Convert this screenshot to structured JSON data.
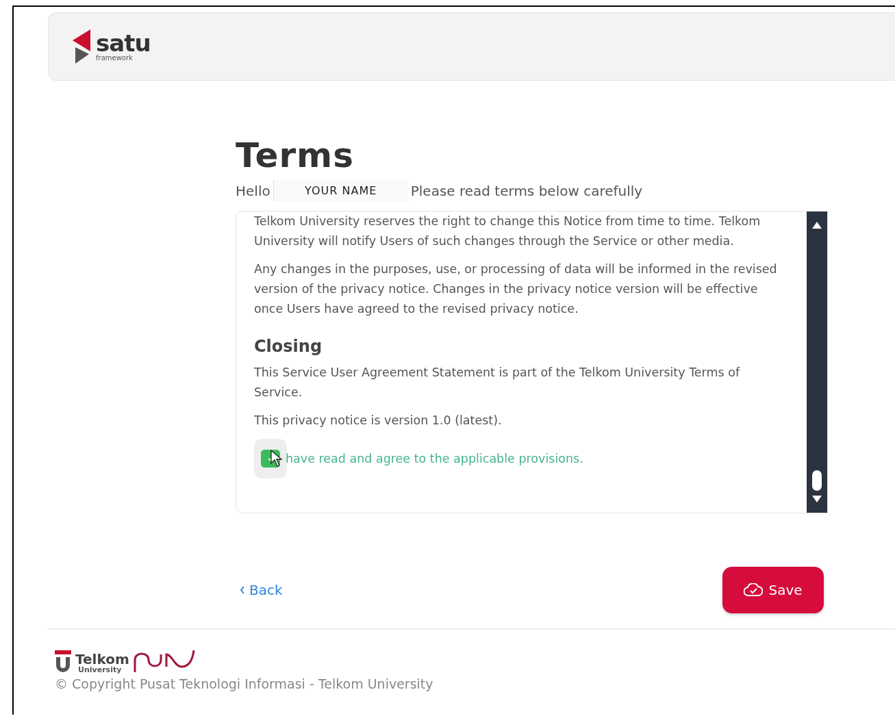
{
  "header": {
    "logo_name": "satu",
    "logo_sub": "framework"
  },
  "title": "Terms",
  "greeting": {
    "hello": "Hello",
    "name": "YOUR NAME",
    "instruction": "Please read terms below carefully"
  },
  "terms": {
    "blocks": [
      {
        "kind": "paragraph",
        "text": "Telkom University reserves the right to change this Notice from time to time. Telkom University will notify Users of such changes through the Service or other media."
      },
      {
        "kind": "paragraph",
        "text": "Any changes in the purposes, use, or processing of data will be informed in the revised version of the privacy notice. Changes in the privacy notice version will be effective once Users have agreed to the revised privacy notice."
      },
      {
        "kind": "heading",
        "text": "Closing"
      },
      {
        "kind": "paragraph",
        "text": "This Service User Agreement Statement is part of the Telkom University Terms of Service."
      },
      {
        "kind": "paragraph",
        "text": "This privacy notice is version 1.0 (latest)."
      }
    ],
    "agree": {
      "label": "have read and agree to the applicable provisions.",
      "checked": true
    }
  },
  "actions": {
    "back": "Back",
    "save": "Save"
  },
  "footer": {
    "brand": "Telkom",
    "brand_sub": "University",
    "copyright": "© Copyright Pusat Teknologi Informasi - Telkom University"
  }
}
